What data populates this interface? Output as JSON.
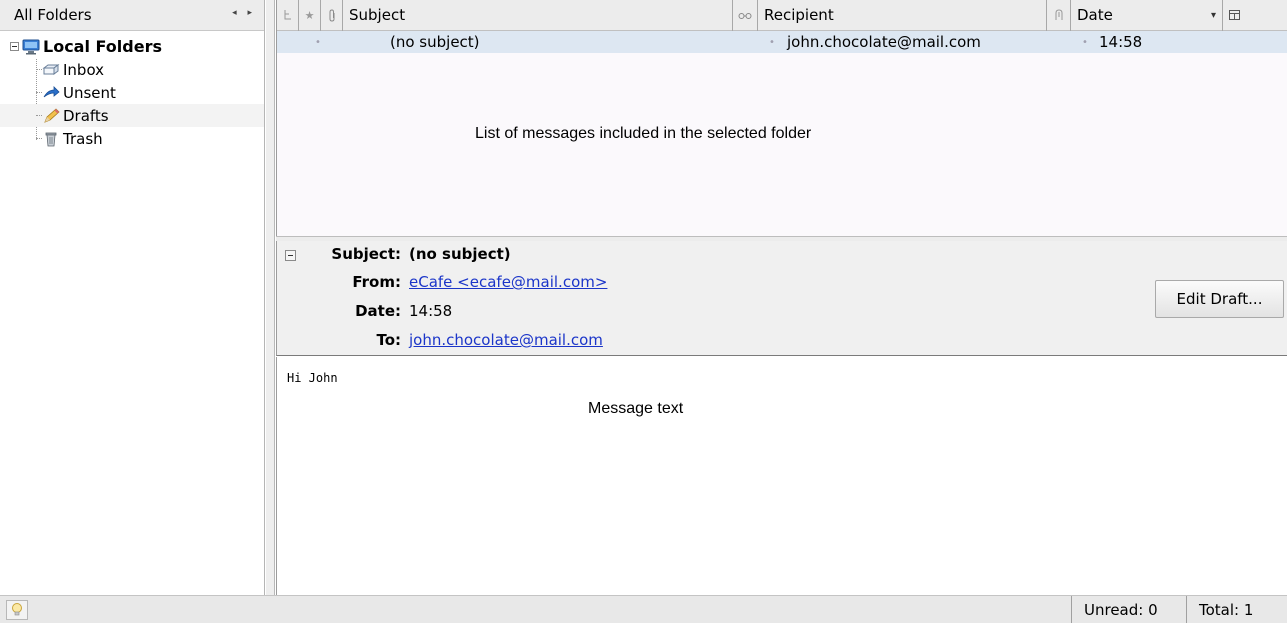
{
  "sidebar": {
    "header_label": "All Folders",
    "root_label": "Local Folders",
    "folders": [
      {
        "label": "Inbox",
        "icon": "inbox-icon"
      },
      {
        "label": "Unsent",
        "icon": "unsent-arrow-icon"
      },
      {
        "label": "Drafts",
        "icon": "pencil-icon"
      },
      {
        "label": "Trash",
        "icon": "trash-icon"
      }
    ],
    "selected_folder": "Drafts"
  },
  "message_list": {
    "columns": {
      "thread": "thread-icon",
      "star": "star-icon",
      "attachment": "attachment-icon",
      "subject": "Subject",
      "read": "read-glasses-icon",
      "recipient": "Recipient",
      "spam": "spam-icon",
      "date": "Date",
      "column_picker": "column-picker-icon"
    },
    "rows": [
      {
        "subject": "(no subject)",
        "recipient": "john.chocolate@mail.com",
        "date": "14:58"
      }
    ],
    "caption": "List of messages included in the selected folder"
  },
  "preview": {
    "subject_label": "Subject:",
    "subject_value": "(no subject)",
    "from_label": "From:",
    "from_value": "eCafe <ecafe@mail.com>",
    "date_label": "Date:",
    "date_value": "14:58",
    "to_label": "To:",
    "to_value": "john.chocolate@mail.com",
    "edit_button": "Edit Draft..."
  },
  "body": {
    "text": "Hi John",
    "caption": "Message text"
  },
  "statusbar": {
    "unread": "Unread: 0",
    "total": "Total: 1"
  },
  "colors": {
    "selected_row": "#dde7f2",
    "link": "#1b35c9",
    "header_bg": "#ececec"
  }
}
